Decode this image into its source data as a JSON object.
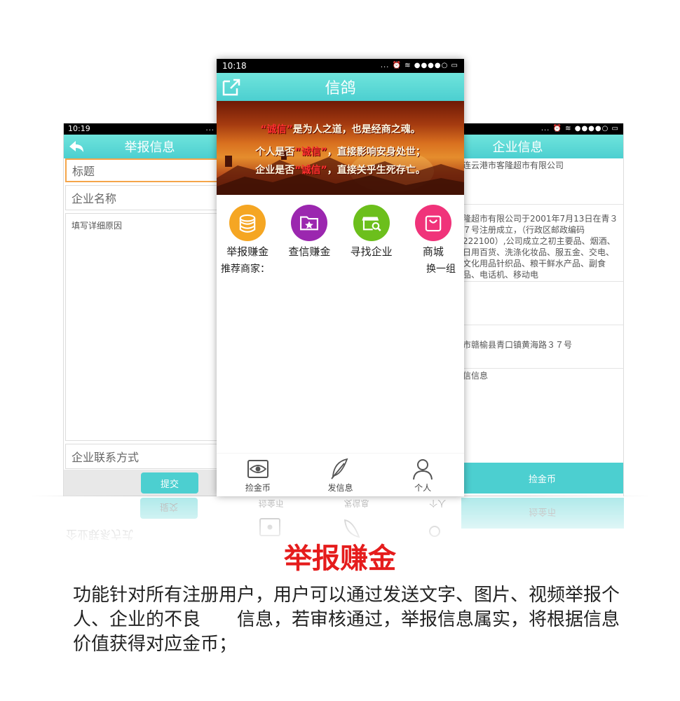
{
  "left_phone": {
    "status_time": "10:19",
    "status_icons": "...",
    "title": "举报信息",
    "fields": {
      "title": "标题",
      "company_name": "企业名称",
      "reason": "填写详细原因",
      "contact": "企业联系方式"
    },
    "submit_label": "提交"
  },
  "center_phone": {
    "status_time": "10:18",
    "status_icons": "... ⏰ ≋ ●●●●○ ▭",
    "title": "信鸽",
    "banner": {
      "line1_a": "“诚信”",
      "line1_b": "是为人之道，也是经商之魂。",
      "line2_a": "个人是否",
      "line2_b": "“诚信”",
      "line2_c": "，直接影响安身处世；",
      "line3_a": "企业是否",
      "line3_b": "“诚信”",
      "line3_c": "，直接关乎生死存亡。"
    },
    "menu": [
      {
        "label": "举报赚金",
        "icon": "coin-stack-icon",
        "color": "#f5a623"
      },
      {
        "label": "查信赚金",
        "icon": "star-folder-icon",
        "color": "#9b27af"
      },
      {
        "label": "寻找企业",
        "icon": "shop-search-icon",
        "color": "#6cbf1c"
      },
      {
        "label": "商城",
        "icon": "shopping-bag-icon",
        "color": "#f0337a"
      }
    ],
    "recommend_label": "推荐商家：",
    "refresh_label": "换一组",
    "tabs": [
      {
        "label": "捡金币",
        "icon": "eye-card-icon"
      },
      {
        "label": "发信息",
        "icon": "feather-icon"
      },
      {
        "label": "个人",
        "icon": "person-icon"
      }
    ]
  },
  "right_phone": {
    "status_icons": "... ⏰ ≋ ●●●●○ ▭",
    "title": "企业信息",
    "company_name": "连云港市客隆超市有限公司",
    "intro": "隆超市有限公司于2001年7月13日在青３７号注册成立，（行政区邮政编码222100）,公司成立之初主要品、烟酒、日用百货、洗涤化妆品、服五金、交电、文化用品针织品、粮干鲜水产品、副食品、电话机、移动电",
    "address": "市赣榆县青口镇黄海路３７号",
    "credit_label": "信信息",
    "gold_button": "捡金币"
  },
  "caption": {
    "title": "举报赚金",
    "description": "功能针对所有注册用户，用户可以通过发送文字、图片、视频举报个人、企业的不良　　信息，若审核通过，举报信息属实，将根据信息价值获得对应金币；"
  },
  "colors": {
    "accent": "#4ccfd0",
    "title_red": "#e51c1c",
    "focus_orange": "#f5a54a"
  }
}
